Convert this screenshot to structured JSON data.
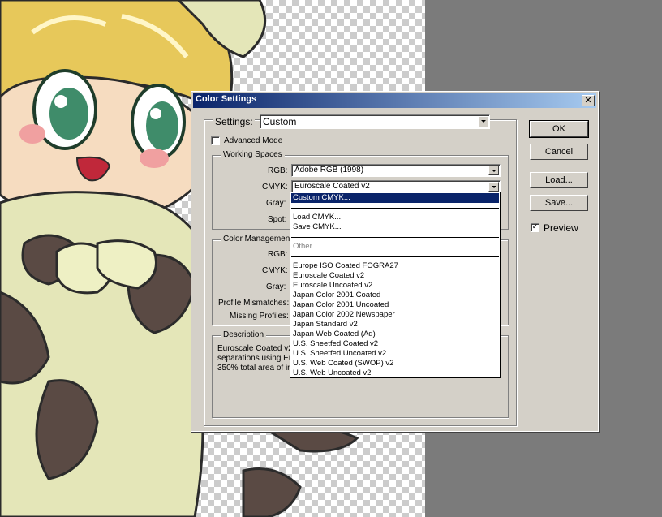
{
  "dialog": {
    "title": "Color Settings",
    "close_symbol": "✕",
    "settings_label": "Settings:",
    "settings_value": "Custom",
    "advanced_mode_label": "Advanced Mode",
    "advanced_mode_checked": false,
    "preview_label": "Preview",
    "preview_checked": true
  },
  "buttons": {
    "ok": "OK",
    "cancel": "Cancel",
    "load": "Load...",
    "save": "Save..."
  },
  "working_spaces": {
    "title": "Working Spaces",
    "rgb_label": "RGB:",
    "rgb_value": "Adobe RGB (1998)",
    "cmyk_label": "CMYK:",
    "cmyk_value": "Euroscale Coated v2",
    "gray_label": "Gray:",
    "spot_label": "Spot:"
  },
  "color_management": {
    "title": "Color Managemen",
    "rgb_label": "RGB:",
    "cmyk_label": "CMYK:",
    "gray_label": "Gray:",
    "profile_mismatches_label": "Profile Mismatches:",
    "missing_profiles_label": "Missing Profiles:"
  },
  "description": {
    "title": "Description",
    "line1": "Euroscale Coated v2",
    "line2": "separations using Eu",
    "line3": "350% total area of in"
  },
  "dropdown": {
    "selected": "Custom CMYK...",
    "load": "Load CMYK...",
    "save": "Save CMYK...",
    "other": "Other",
    "profiles": [
      "Europe ISO Coated FOGRA27",
      "Euroscale Coated v2",
      "Euroscale Uncoated v2",
      "Japan Color 2001 Coated",
      "Japan Color 2001 Uncoated",
      "Japan Color 2002 Newspaper",
      "Japan Standard v2",
      "Japan Web Coated (Ad)",
      "U.S. Sheetfed Coated v2",
      "U.S. Sheetfed Uncoated v2",
      "U.S. Web Coated (SWOP) v2",
      "U.S. Web Uncoated v2"
    ]
  },
  "colors": {
    "title_gradient_start": "#0a246a",
    "title_gradient_end": "#a6caf0",
    "dialog_face": "#d4d0c8",
    "selection": "#0a246a",
    "workspace_gray": "#7b7b7b"
  }
}
